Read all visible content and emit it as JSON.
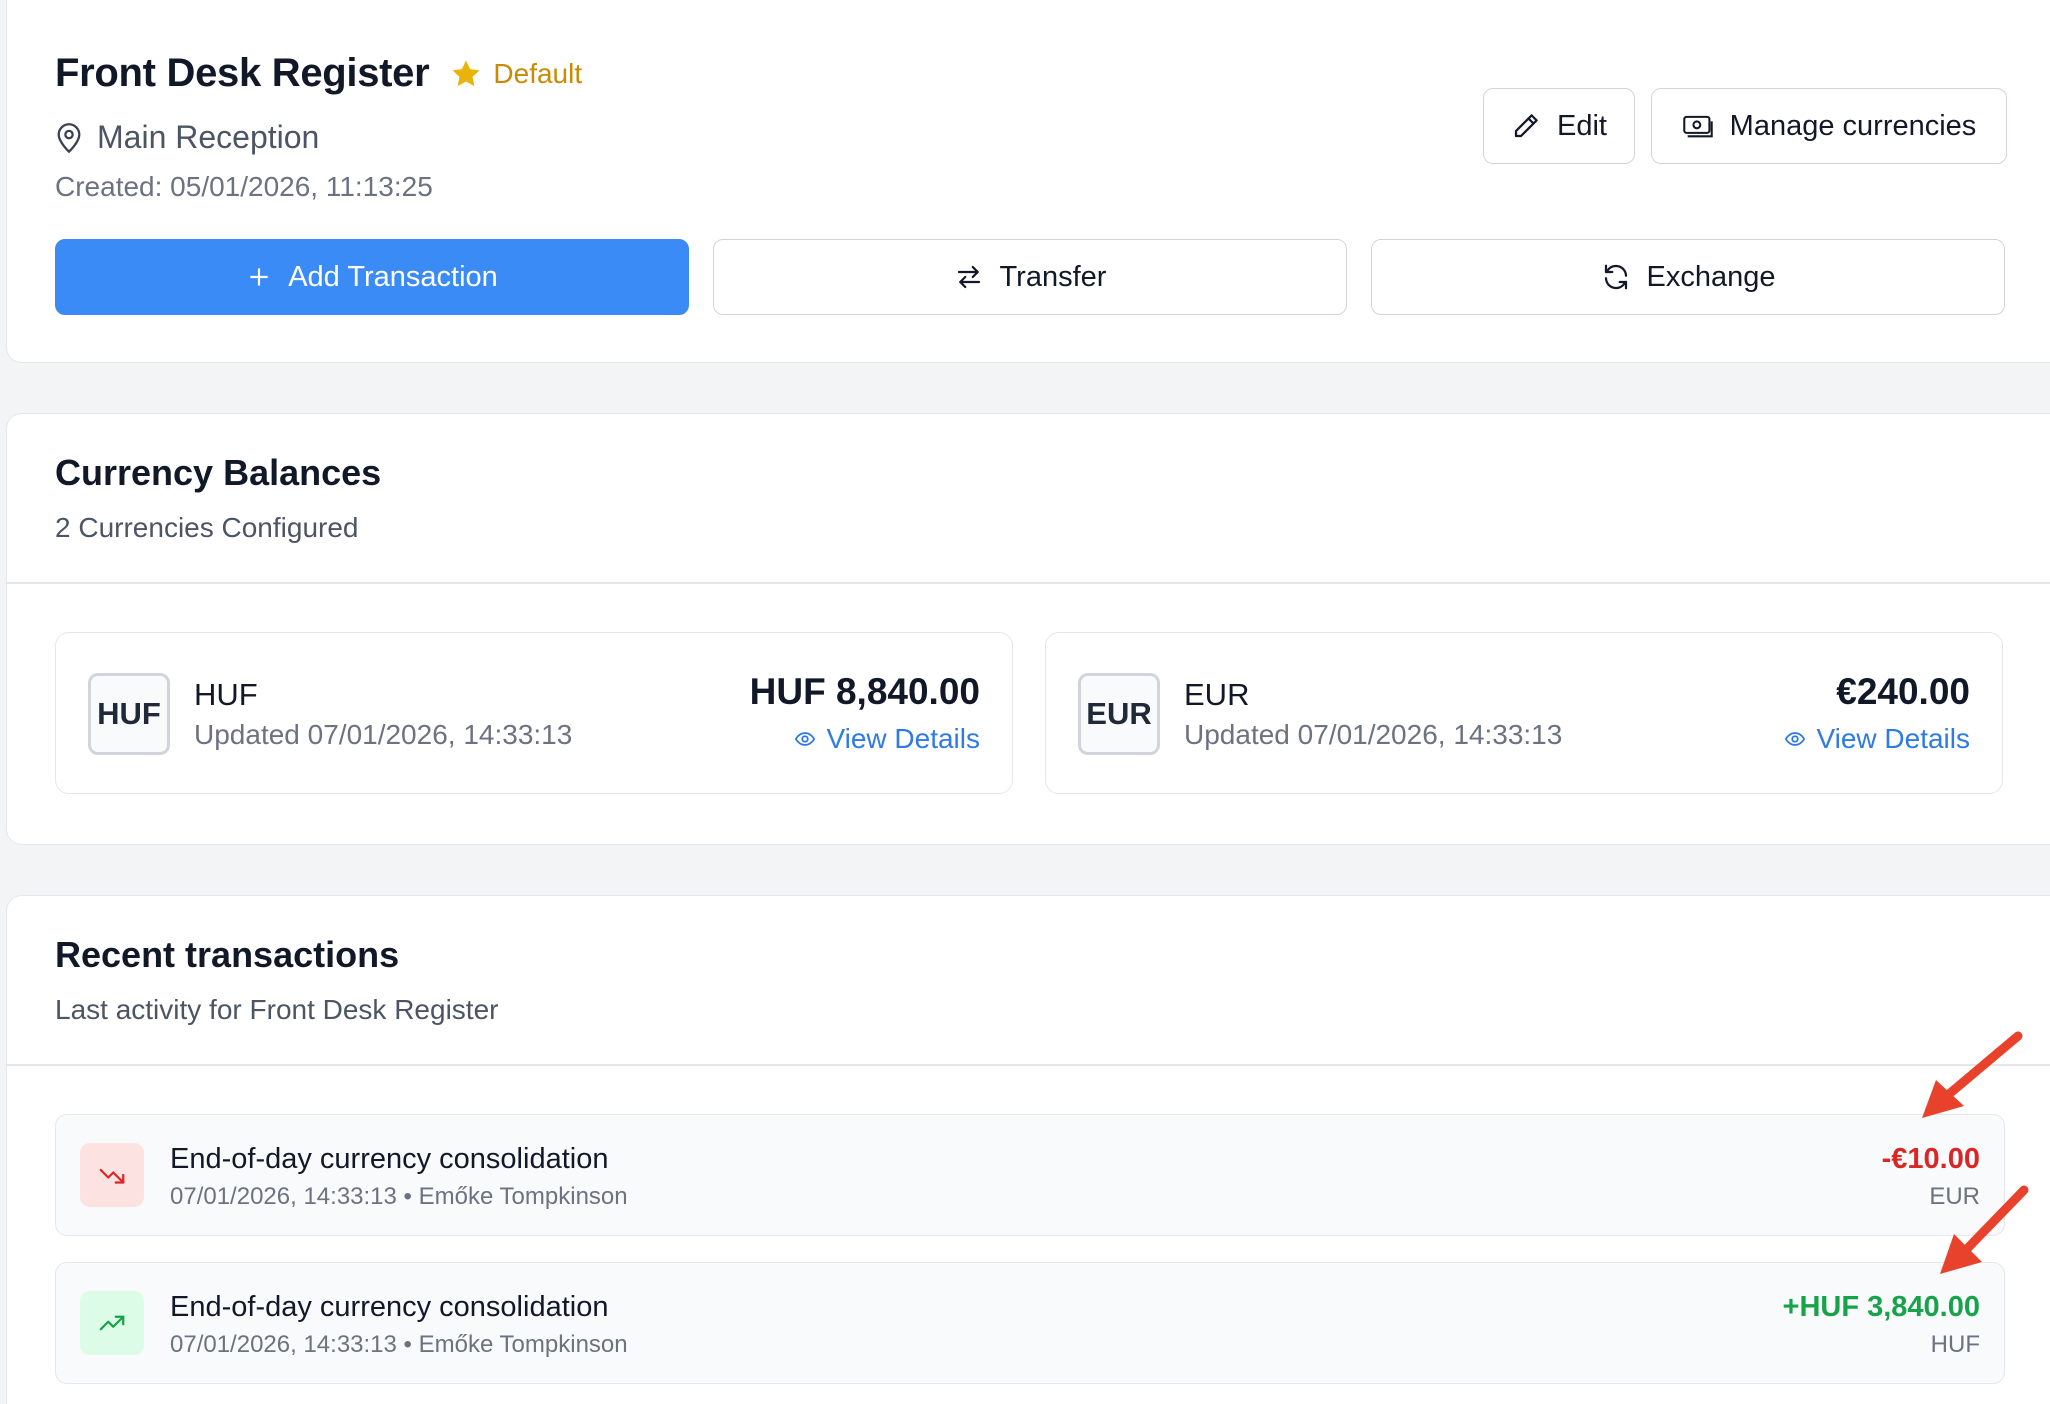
{
  "register": {
    "title": "Front Desk Register",
    "badge": "Default",
    "location": "Main Reception",
    "created": "Created: 05/01/2026, 11:13:25"
  },
  "actions": {
    "edit": "Edit",
    "manage_currencies": "Manage currencies",
    "add_transaction": "Add Transaction",
    "transfer": "Transfer",
    "exchange": "Exchange"
  },
  "balances": {
    "title": "Currency Balances",
    "subtitle": "2 Currencies Configured",
    "items": [
      {
        "code": "HUF",
        "name": "HUF",
        "updated": "Updated 07/01/2026, 14:33:13",
        "amount": "HUF 8,840.00",
        "link": "View Details"
      },
      {
        "code": "EUR",
        "name": "EUR",
        "updated": "Updated 07/01/2026, 14:33:13",
        "amount": "€240.00",
        "link": "View Details"
      }
    ]
  },
  "transactions": {
    "title": "Recent transactions",
    "subtitle": "Last activity for Front Desk Register",
    "items": [
      {
        "title": "End-of-day currency consolidation",
        "meta": "07/01/2026, 14:33:13 • Emőke Tompkinson",
        "amount": "-€10.00",
        "currency": "EUR",
        "direction": "out"
      },
      {
        "title": "End-of-day currency consolidation",
        "meta": "07/01/2026, 14:33:13 • Emőke Tompkinson",
        "amount": "+HUF 3,840.00",
        "currency": "HUF",
        "direction": "in"
      }
    ]
  },
  "colors": {
    "primary": "#3b8bf6",
    "link": "#2f7ae5",
    "badge": "#ca8a04",
    "negative": "#dc2626",
    "positive": "#16a34a",
    "annotation_arrow": "#e8412c"
  }
}
